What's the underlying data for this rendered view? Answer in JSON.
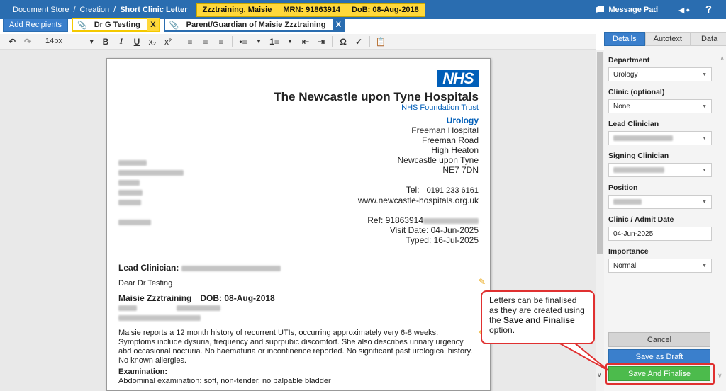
{
  "header": {
    "breadcrumb": [
      "Document Store",
      "Creation",
      "Short Clinic Letter"
    ],
    "separator": "/",
    "patient_name": "Zzztraining, Maisie",
    "mrn": "MRN: 91863914",
    "dob": "DoB: 08-Aug-2018",
    "message_pad": "Message Pad",
    "help": "?"
  },
  "recipients": {
    "add_label": "Add Recipients",
    "items": [
      {
        "name": "Dr G Testing",
        "remove": "X",
        "color": "#ffd83a"
      },
      {
        "name": "Parent/Guardian of Maisie Zzztraining",
        "remove": "X",
        "color": "#2a6db0"
      }
    ]
  },
  "toolbar": {
    "font_size": "14px",
    "bold": "B",
    "italic": "I",
    "underline": "U",
    "subscript": "x₂",
    "superscript": "x²",
    "omega": "Ω"
  },
  "letter": {
    "logo": "NHS",
    "trust_name": "The Newcastle upon Tyne Hospitals",
    "trust_sub": "NHS Foundation Trust",
    "department": "Urology",
    "address": [
      "Freeman Hospital",
      "Freeman Road",
      "High Heaton",
      "Newcastle upon Tyne",
      "NE7 7DN"
    ],
    "tel_label": "Tel:",
    "tel": "0191 233 6161",
    "website": "www.newcastle-hospitals.org.uk",
    "ref_label": "Ref: 91863914",
    "visit_date": "Visit Date: 04-Jun-2025",
    "typed": "Typed: 16-Jul-2025",
    "lead_label": "Lead Clinician:",
    "salutation": "Dear Dr Testing",
    "patient_name": "Maisie Zzztraining",
    "patient_dob": "DOB: 08-Aug-2018",
    "body": "Maisie reports a 12 month history of recurrent UTIs, occurring approximately very 6-8 weeks. Symptoms include dysuria, frequency and suprpubic discomfort. She also describes urinary urgency abd occasional nocturia. No haematuria or incontinence reported. No significant past urological history. No known allergies.",
    "exam_heading": "Examination:",
    "exam_text": "Abdominal examination: soft, non-tender, no palpable bladder"
  },
  "panel": {
    "tabs": [
      "Details",
      "Autotext",
      "Data"
    ],
    "department_label": "Department",
    "department_value": "Urology",
    "clinic_label": "Clinic (optional)",
    "clinic_value": "None",
    "lead_label": "Lead Clinician",
    "signing_label": "Signing Clinician",
    "position_label": "Position",
    "date_label": "Clinic / Admit Date",
    "date_value": "04-Jun-2025",
    "importance_label": "Importance",
    "importance_value": "Normal",
    "cancel": "Cancel",
    "draft": "Save as Draft",
    "finalise": "Save And Finalise"
  },
  "callout": {
    "text_a": "Letters can be finalised as they are created using the ",
    "text_bold": "Save and Finalise",
    "text_b": " option."
  },
  "colors": {
    "brand": "#2a6db0",
    "nhs_blue": "#005eb8",
    "highlight": "#e03030",
    "finalise": "#4cbb4c"
  }
}
